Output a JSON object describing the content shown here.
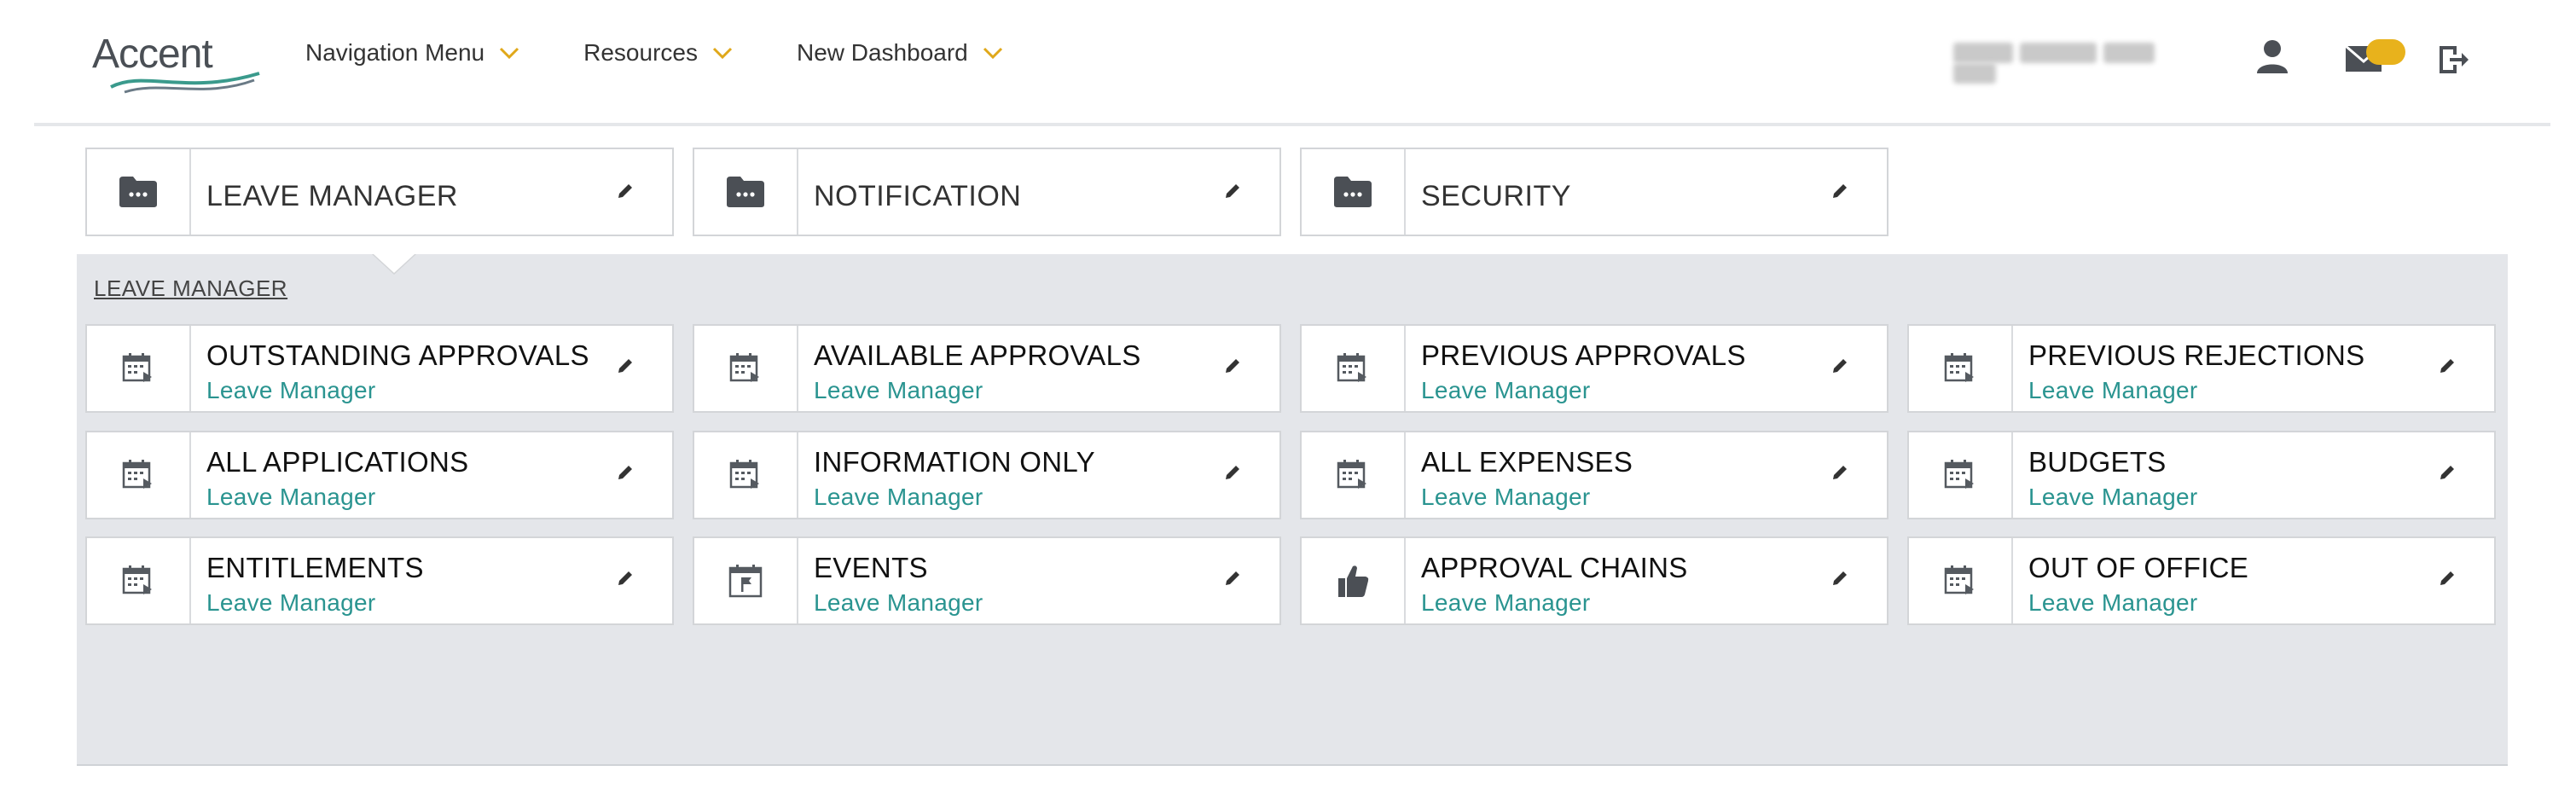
{
  "header": {
    "logo_text": "Accent",
    "nav": [
      {
        "label": "Navigation Menu"
      },
      {
        "label": "Resources"
      },
      {
        "label": "New Dashboard"
      }
    ],
    "icons": {
      "user": "user-icon",
      "mail": "mail-icon",
      "logout": "logout-icon",
      "chevron": "chevron-down-icon"
    },
    "colors": {
      "accent": "#e8b21c",
      "logo_swoosh": "#3a9a8c"
    }
  },
  "top_tabs": [
    {
      "label": "LEAVE MANAGER",
      "icon": "folder-icon"
    },
    {
      "label": "NOTIFICATION",
      "icon": "folder-icon"
    },
    {
      "label": "SECURITY",
      "icon": "folder-icon"
    }
  ],
  "section": {
    "title": "LEAVE MANAGER"
  },
  "tiles": [
    {
      "title": "OUTSTANDING APPROVALS",
      "subtitle": "Leave Manager",
      "icon": "calendar-icon"
    },
    {
      "title": "AVAILABLE APPROVALS",
      "subtitle": "Leave Manager",
      "icon": "calendar-icon"
    },
    {
      "title": "PREVIOUS APPROVALS",
      "subtitle": "Leave Manager",
      "icon": "calendar-icon"
    },
    {
      "title": "PREVIOUS REJECTIONS",
      "subtitle": "Leave Manager",
      "icon": "calendar-icon"
    },
    {
      "title": "ALL APPLICATIONS",
      "subtitle": "Leave Manager",
      "icon": "calendar-icon"
    },
    {
      "title": "INFORMATION ONLY",
      "subtitle": "Leave Manager",
      "icon": "calendar-icon"
    },
    {
      "title": "ALL EXPENSES",
      "subtitle": "Leave Manager",
      "icon": "calendar-icon"
    },
    {
      "title": "BUDGETS",
      "subtitle": "Leave Manager",
      "icon": "calendar-icon"
    },
    {
      "title": "ENTITLEMENTS",
      "subtitle": "Leave Manager",
      "icon": "calendar-icon"
    },
    {
      "title": "EVENTS",
      "subtitle": "Leave Manager",
      "icon": "event-flag-icon"
    },
    {
      "title": "APPROVAL CHAINS",
      "subtitle": "Leave Manager",
      "icon": "thumbs-up-icon"
    },
    {
      "title": "OUT OF OFFICE",
      "subtitle": "Leave Manager",
      "icon": "calendar-icon"
    }
  ],
  "colors": {
    "subtitle": "#2a9490",
    "panel_bg": "#e4e6ea",
    "icon": "#555a60"
  }
}
